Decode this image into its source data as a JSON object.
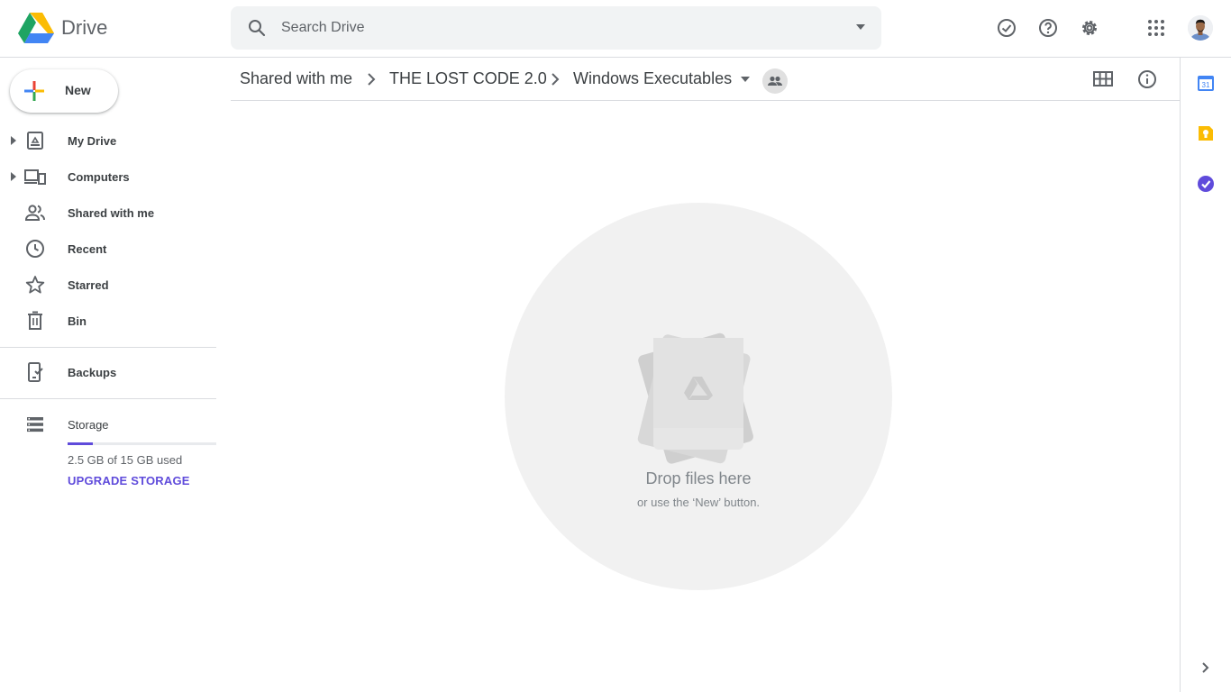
{
  "header": {
    "app_name": "Drive",
    "search_placeholder": "Search Drive"
  },
  "icons": {
    "offline": "check-circle-icon",
    "help": "help-icon",
    "settings": "gear-icon",
    "apps": "apps-grid-icon"
  },
  "sidebar": {
    "new_label": "New",
    "items": [
      {
        "label": "My Drive",
        "icon": "my-drive-icon"
      },
      {
        "label": "Computers",
        "icon": "computers-icon"
      },
      {
        "label": "Shared with me",
        "icon": "people-icon"
      },
      {
        "label": "Recent",
        "icon": "clock-icon"
      },
      {
        "label": "Starred",
        "icon": "star-icon"
      },
      {
        "label": "Bin",
        "icon": "trash-icon"
      },
      {
        "label": "Backups",
        "icon": "backup-icon"
      },
      {
        "label": "Storage",
        "icon": "storage-icon"
      }
    ],
    "storage": {
      "used_text": "2.5 GB of 15 GB used",
      "used_fraction": 0.167,
      "upgrade_label": "UPGRADE STORAGE"
    }
  },
  "breadcrumb": {
    "items": [
      "Shared with me",
      "THE LOST CODE 2.0",
      "Windows Executables"
    ]
  },
  "empty_state": {
    "title": "Drop files here",
    "subtitle": "or use the ‘New’ button."
  },
  "rail": {
    "calendar_day": "31"
  },
  "colors": {
    "accent": "#5f4bdb",
    "keep": "#fbbc04",
    "tasks": "#5f4bdb"
  }
}
